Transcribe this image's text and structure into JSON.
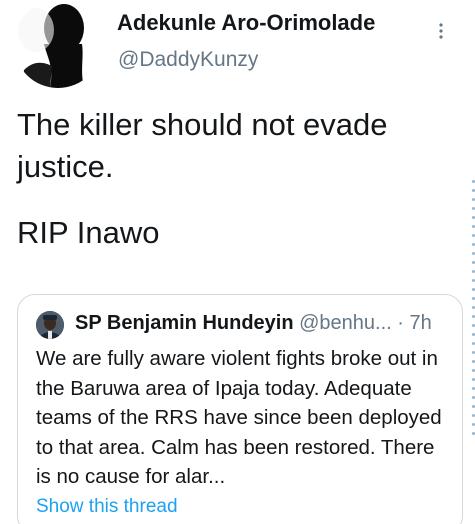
{
  "author": {
    "name": "Adekunle Aro-Orimolade",
    "handle": "@DaddyKunzy",
    "avatar_icon": "profile-silhouette"
  },
  "tweet": {
    "paragraphs": [
      "The killer should not evade justice.",
      "RIP Inawo"
    ]
  },
  "more_icon": "vertical-ellipsis",
  "quoted_tweet": {
    "author_name": "SP Benjamin Hundeyin",
    "author_handle": "@benhu...",
    "separator": "·",
    "time": "7h",
    "avatar_icon": "police-officer-avatar",
    "text": "We are fully aware violent fights broke out in the Baruwa area of Ipaja today. Adequate teams of the RRS have since been deployed to that area. Calm has been restored. There is no cause for alar...",
    "show_thread_label": "Show this thread"
  },
  "colors": {
    "text": "#14171a",
    "secondary": "#657786",
    "link": "#1da1f2",
    "border": "#cfd9de"
  }
}
